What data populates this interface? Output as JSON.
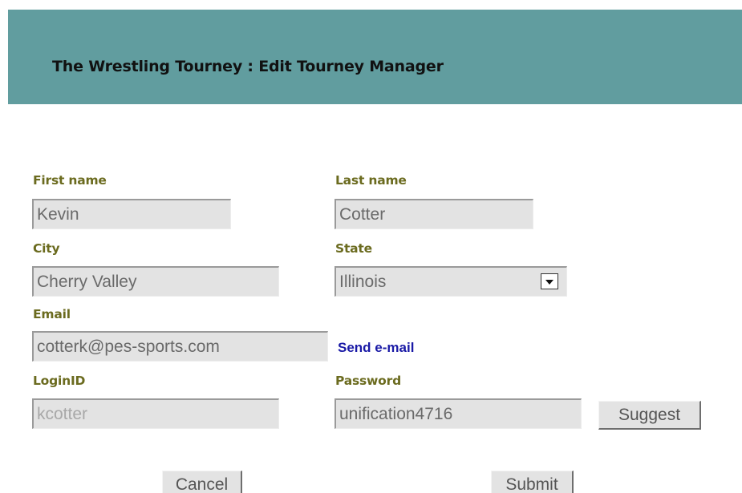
{
  "header": {
    "title": "The Wrestling Tourney : Edit Tourney Manager"
  },
  "form": {
    "first_name": {
      "label": "First name",
      "value": "Kevin"
    },
    "last_name": {
      "label": "Last name",
      "value": "Cotter"
    },
    "city": {
      "label": "City",
      "value": "Cherry Valley"
    },
    "state": {
      "label": "State",
      "value": "Illinois"
    },
    "email": {
      "label": "Email",
      "value": "cotterk@pes-sports.com",
      "link": "Send e-mail"
    },
    "login_id": {
      "label": "LoginID",
      "value": "kcotter"
    },
    "password": {
      "label": "Password",
      "value": "unification4716",
      "suggest_label": "Suggest"
    }
  },
  "actions": {
    "cancel_label": "Cancel",
    "submit_label": "Submit"
  },
  "colors": {
    "header_bg": "#619d9f",
    "label_color": "#6b6b1f",
    "link_color": "#1a1aa6",
    "field_bg": "#e3e3e3"
  },
  "icons": {
    "state_dropdown": "chevron-down-icon"
  }
}
